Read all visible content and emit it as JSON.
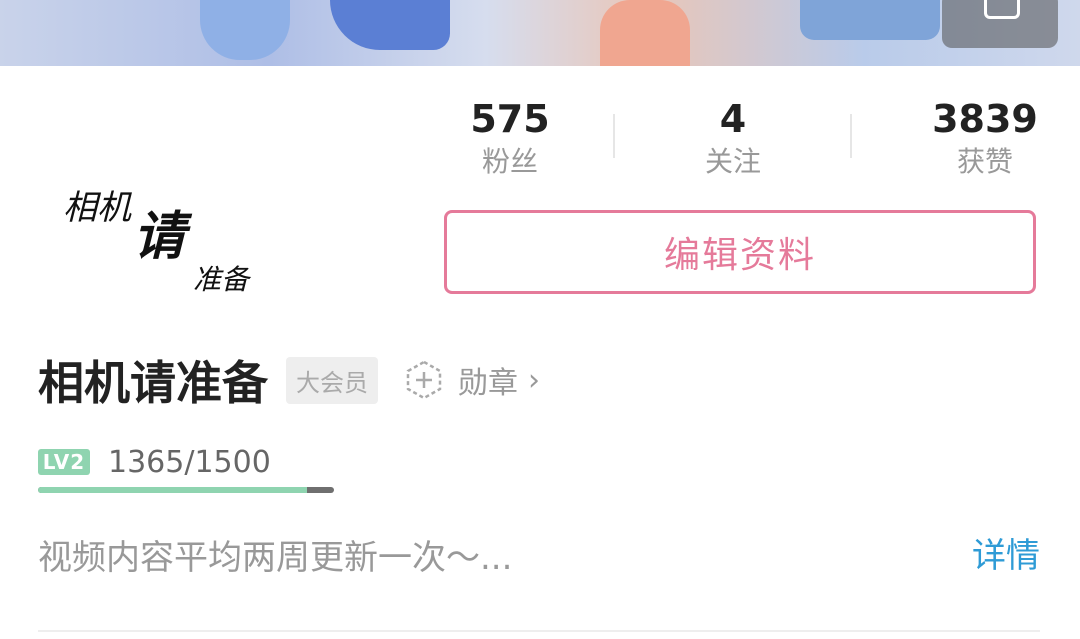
{
  "avatar": {
    "line1": "相机",
    "line2": "请",
    "line3": "准备"
  },
  "stats": [
    {
      "value": "575",
      "label": "粉丝"
    },
    {
      "value": "4",
      "label": "关注"
    },
    {
      "value": "3839",
      "label": "获赞"
    }
  ],
  "edit_button": "编辑资料",
  "profile": {
    "name": "相机请准备",
    "vip_label": "大会员",
    "medal_label": "勋章",
    "chevron": "›",
    "level_badge": "LV2",
    "exp_text": "1365/1500",
    "exp_progress": 0.91,
    "bio": "视频内容平均两周更新一次～...",
    "detail_link": "详情"
  },
  "colors": {
    "accent_pink": "#e57a9a",
    "link_blue": "#2e9bd6",
    "level_green": "#8fd4b0"
  }
}
